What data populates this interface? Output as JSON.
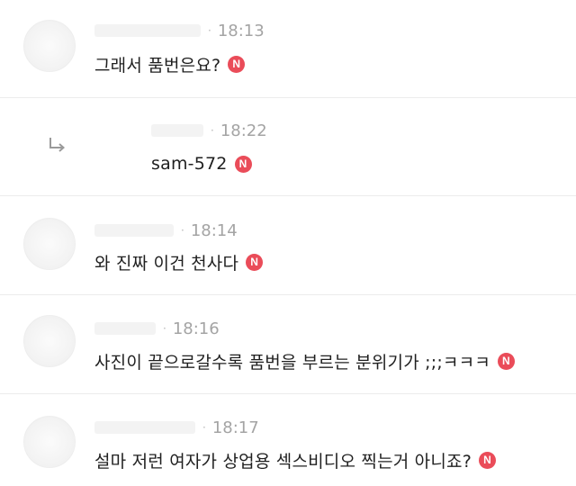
{
  "comments": [
    {
      "time": "18:13",
      "text": "그래서 품번은요?",
      "badge": "N",
      "is_reply": false
    },
    {
      "time": "18:22",
      "text": "sam-572",
      "badge": "N",
      "is_reply": true
    },
    {
      "time": "18:14",
      "text": "와 진짜 이건 천사다",
      "badge": "N",
      "is_reply": false
    },
    {
      "time": "18:16",
      "text": "사진이 끝으로갈수록 품번을 부르는 분위기가 ;;;ㅋㅋㅋ",
      "badge": "N",
      "is_reply": false
    },
    {
      "time": "18:17",
      "text": "설마 저런 여자가 상업용 섹스비디오 찍는거 아니죠?",
      "badge": "N",
      "is_reply": false
    }
  ],
  "separator": "·",
  "icons": {
    "reply": "reply-arrow-icon"
  },
  "colors": {
    "badge": "#ea4c59",
    "meta": "#a4a4a4",
    "text": "#1f1f1f",
    "divider": "#ececec"
  }
}
